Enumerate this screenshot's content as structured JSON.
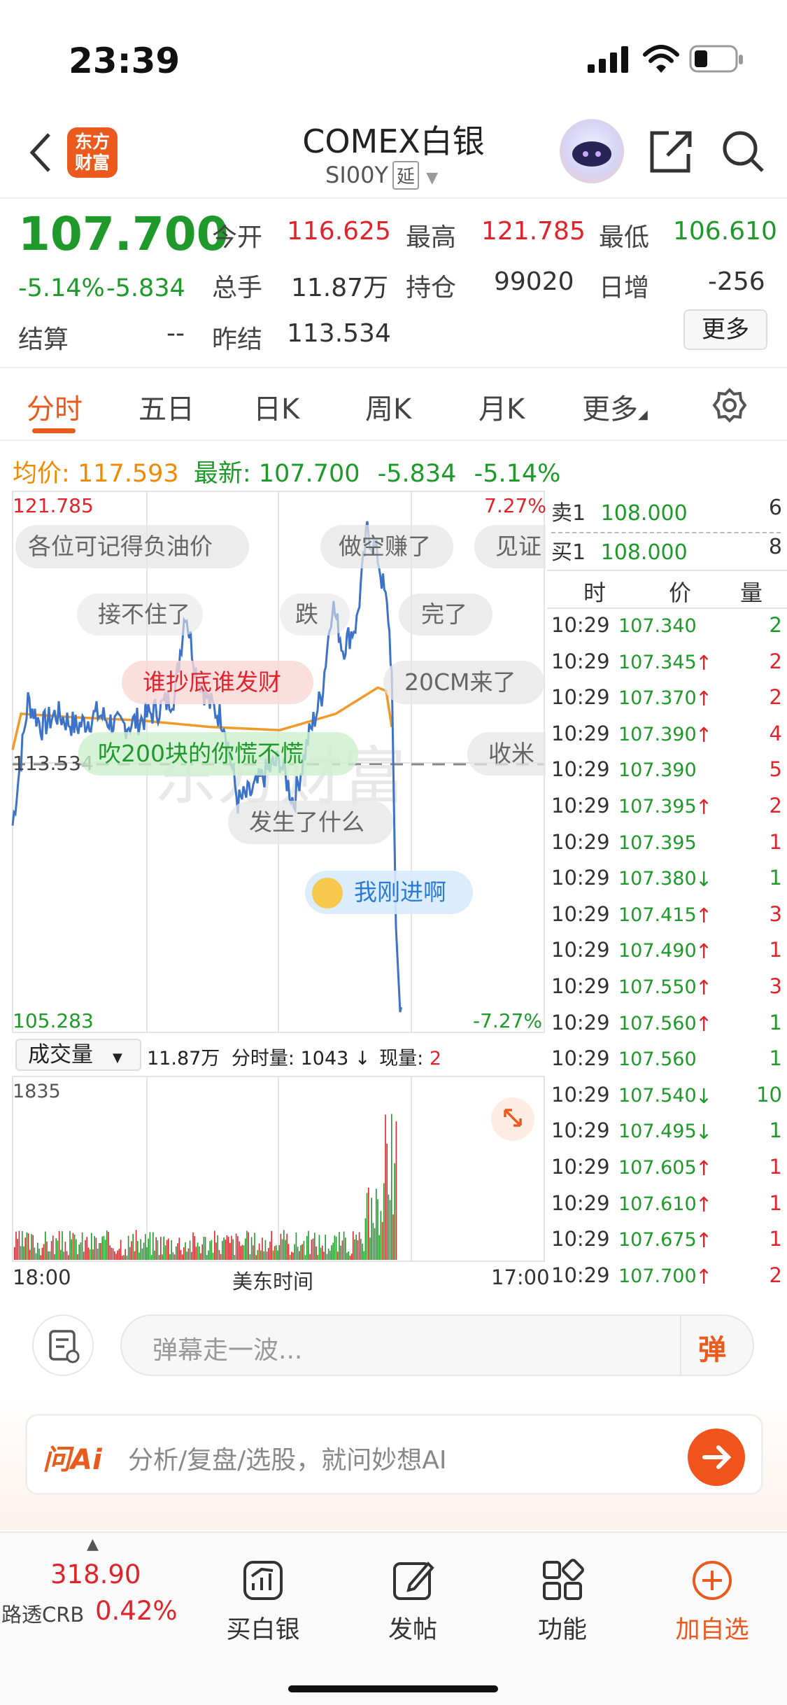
{
  "status_bar": {
    "time": "23:39"
  },
  "header": {
    "logo_line1": "东方",
    "logo_line2": "财富",
    "title": "COMEX白银",
    "code": "SI00Y",
    "delay_badge": "延"
  },
  "quote": {
    "price": "107.700",
    "change_pct": "-5.14%",
    "change": "-5.834",
    "open_label": "今开",
    "open": "116.625",
    "high_label": "最高",
    "high": "121.785",
    "low_label": "最低",
    "low": "106.610",
    "volume_label": "总手",
    "volume": "11.87万",
    "oi_label": "持仓",
    "oi": "99020",
    "inc_label": "日增",
    "inc": "-256",
    "settle_label": "结算",
    "settle": "--",
    "prev_label": "昨结",
    "prev": "113.534",
    "more_label": "更多"
  },
  "tabs": [
    {
      "label": "分时",
      "active": true
    },
    {
      "label": "五日"
    },
    {
      "label": "日K"
    },
    {
      "label": "周K"
    },
    {
      "label": "月K"
    },
    {
      "label": "更多"
    }
  ],
  "avgline": {
    "avg_label": "均价:",
    "avg": "117.593",
    "latest_label": "最新:",
    "latest": "107.700",
    "chg": "-5.834",
    "pct": "-5.14%"
  },
  "chart": {
    "high_label": "121.785",
    "high_pct": "7.27%",
    "ref_label": "113.534",
    "low_label": "105.283",
    "low_pct": "-7.27%",
    "danmaku": [
      "各位可记得负油价",
      "做空赚了",
      "见证",
      "接不住了",
      "跌",
      "完了",
      "谁抄底谁发财",
      "20CM来了",
      "吹200块的你慌不慌",
      "收米",
      "发生了什么",
      "我刚进啊"
    ],
    "watermark": "东方财富"
  },
  "volume": {
    "select_label": "成交量",
    "total": "11.87万",
    "tick_label": "分时量:",
    "tick_value": "1043",
    "tick_arrow": "↓",
    "now_label": "现量:",
    "now_value": "2",
    "max": "1835"
  },
  "time_axis": {
    "start": "18:00",
    "middle": "美东时间",
    "end": "17:00"
  },
  "chart_data": {
    "type": "line",
    "title": "",
    "ylim": [
      105.283,
      121.785
    ],
    "reference": 113.534,
    "volume_max": 1835,
    "x": [
      "18:00",
      "17:00"
    ],
    "note_series": [
      "price",
      "avg"
    ]
  },
  "orderbook": {
    "ask": {
      "label": "卖1",
      "price": "108.000",
      "qty": "6"
    },
    "bid": {
      "label": "买1",
      "price": "108.000",
      "qty": "8"
    },
    "headers": [
      "时",
      "价",
      "量"
    ],
    "rows": [
      {
        "t": "10:29",
        "p": "107.340",
        "a": "",
        "q": "2",
        "c": "green"
      },
      {
        "t": "10:29",
        "p": "107.345",
        "a": "↑",
        "q": "2",
        "c": "red"
      },
      {
        "t": "10:29",
        "p": "107.370",
        "a": "↑",
        "q": "2",
        "c": "red"
      },
      {
        "t": "10:29",
        "p": "107.390",
        "a": "↑",
        "q": "4",
        "c": "red"
      },
      {
        "t": "10:29",
        "p": "107.390",
        "a": "",
        "q": "5",
        "c": "red"
      },
      {
        "t": "10:29",
        "p": "107.395",
        "a": "↑",
        "q": "2",
        "c": "red"
      },
      {
        "t": "10:29",
        "p": "107.395",
        "a": "",
        "q": "1",
        "c": "red"
      },
      {
        "t": "10:29",
        "p": "107.380",
        "a": "↓",
        "q": "1",
        "c": "green"
      },
      {
        "t": "10:29",
        "p": "107.415",
        "a": "↑",
        "q": "3",
        "c": "red"
      },
      {
        "t": "10:29",
        "p": "107.490",
        "a": "↑",
        "q": "1",
        "c": "red"
      },
      {
        "t": "10:29",
        "p": "107.550",
        "a": "↑",
        "q": "3",
        "c": "red"
      },
      {
        "t": "10:29",
        "p": "107.560",
        "a": "↑",
        "q": "1",
        "c": "green"
      },
      {
        "t": "10:29",
        "p": "107.560",
        "a": "",
        "q": "1",
        "c": "green"
      },
      {
        "t": "10:29",
        "p": "107.540",
        "a": "↓",
        "q": "10",
        "c": "green"
      },
      {
        "t": "10:29",
        "p": "107.495",
        "a": "↓",
        "q": "1",
        "c": "green"
      },
      {
        "t": "10:29",
        "p": "107.605",
        "a": "↑",
        "q": "1",
        "c": "red"
      },
      {
        "t": "10:29",
        "p": "107.610",
        "a": "↑",
        "q": "1",
        "c": "red"
      },
      {
        "t": "10:29",
        "p": "107.675",
        "a": "↑",
        "q": "1",
        "c": "red"
      },
      {
        "t": "10:29",
        "p": "107.700",
        "a": "↑",
        "q": "2",
        "c": "red"
      }
    ]
  },
  "comment": {
    "placeholder": "弹幕走一波...",
    "danmu_btn": "弹"
  },
  "ai": {
    "brand": "问Ai",
    "placeholder": "分析/复盘/选股，就问妙想AI"
  },
  "bottomnav": {
    "index_value": "318.90",
    "index_name": "路透CRB",
    "index_pct": "0.42%",
    "buy": "买白银",
    "post": "发帖",
    "func": "功能",
    "add": "加自选"
  },
  "colors": {
    "up": "#e0242b",
    "down": "#1f9a2a",
    "accent": "#ea5a1c",
    "line": "#3c72c7",
    "avg": "#f09a2a"
  }
}
